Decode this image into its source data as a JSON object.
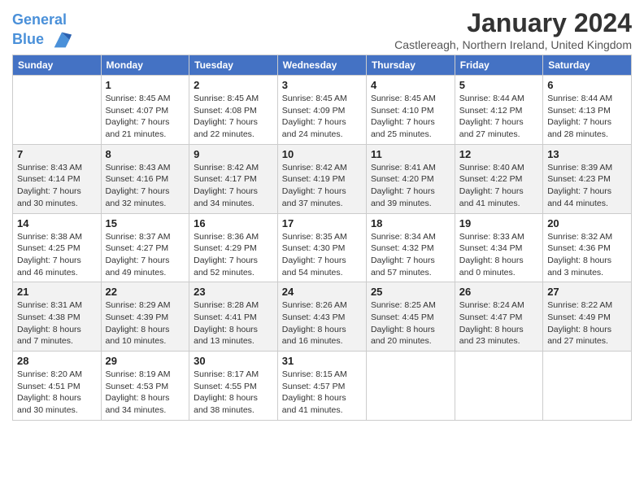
{
  "header": {
    "logo_line1": "General",
    "logo_line2": "Blue",
    "month_title": "January 2024",
    "location": "Castlereagh, Northern Ireland, United Kingdom"
  },
  "weekdays": [
    "Sunday",
    "Monday",
    "Tuesday",
    "Wednesday",
    "Thursday",
    "Friday",
    "Saturday"
  ],
  "weeks": [
    [
      {
        "day": "",
        "sunrise": "",
        "sunset": "",
        "daylight": ""
      },
      {
        "day": "1",
        "sunrise": "Sunrise: 8:45 AM",
        "sunset": "Sunset: 4:07 PM",
        "daylight": "Daylight: 7 hours and 21 minutes."
      },
      {
        "day": "2",
        "sunrise": "Sunrise: 8:45 AM",
        "sunset": "Sunset: 4:08 PM",
        "daylight": "Daylight: 7 hours and 22 minutes."
      },
      {
        "day": "3",
        "sunrise": "Sunrise: 8:45 AM",
        "sunset": "Sunset: 4:09 PM",
        "daylight": "Daylight: 7 hours and 24 minutes."
      },
      {
        "day": "4",
        "sunrise": "Sunrise: 8:45 AM",
        "sunset": "Sunset: 4:10 PM",
        "daylight": "Daylight: 7 hours and 25 minutes."
      },
      {
        "day": "5",
        "sunrise": "Sunrise: 8:44 AM",
        "sunset": "Sunset: 4:12 PM",
        "daylight": "Daylight: 7 hours and 27 minutes."
      },
      {
        "day": "6",
        "sunrise": "Sunrise: 8:44 AM",
        "sunset": "Sunset: 4:13 PM",
        "daylight": "Daylight: 7 hours and 28 minutes."
      }
    ],
    [
      {
        "day": "7",
        "sunrise": "Sunrise: 8:43 AM",
        "sunset": "Sunset: 4:14 PM",
        "daylight": "Daylight: 7 hours and 30 minutes."
      },
      {
        "day": "8",
        "sunrise": "Sunrise: 8:43 AM",
        "sunset": "Sunset: 4:16 PM",
        "daylight": "Daylight: 7 hours and 32 minutes."
      },
      {
        "day": "9",
        "sunrise": "Sunrise: 8:42 AM",
        "sunset": "Sunset: 4:17 PM",
        "daylight": "Daylight: 7 hours and 34 minutes."
      },
      {
        "day": "10",
        "sunrise": "Sunrise: 8:42 AM",
        "sunset": "Sunset: 4:19 PM",
        "daylight": "Daylight: 7 hours and 37 minutes."
      },
      {
        "day": "11",
        "sunrise": "Sunrise: 8:41 AM",
        "sunset": "Sunset: 4:20 PM",
        "daylight": "Daylight: 7 hours and 39 minutes."
      },
      {
        "day": "12",
        "sunrise": "Sunrise: 8:40 AM",
        "sunset": "Sunset: 4:22 PM",
        "daylight": "Daylight: 7 hours and 41 minutes."
      },
      {
        "day": "13",
        "sunrise": "Sunrise: 8:39 AM",
        "sunset": "Sunset: 4:23 PM",
        "daylight": "Daylight: 7 hours and 44 minutes."
      }
    ],
    [
      {
        "day": "14",
        "sunrise": "Sunrise: 8:38 AM",
        "sunset": "Sunset: 4:25 PM",
        "daylight": "Daylight: 7 hours and 46 minutes."
      },
      {
        "day": "15",
        "sunrise": "Sunrise: 8:37 AM",
        "sunset": "Sunset: 4:27 PM",
        "daylight": "Daylight: 7 hours and 49 minutes."
      },
      {
        "day": "16",
        "sunrise": "Sunrise: 8:36 AM",
        "sunset": "Sunset: 4:29 PM",
        "daylight": "Daylight: 7 hours and 52 minutes."
      },
      {
        "day": "17",
        "sunrise": "Sunrise: 8:35 AM",
        "sunset": "Sunset: 4:30 PM",
        "daylight": "Daylight: 7 hours and 54 minutes."
      },
      {
        "day": "18",
        "sunrise": "Sunrise: 8:34 AM",
        "sunset": "Sunset: 4:32 PM",
        "daylight": "Daylight: 7 hours and 57 minutes."
      },
      {
        "day": "19",
        "sunrise": "Sunrise: 8:33 AM",
        "sunset": "Sunset: 4:34 PM",
        "daylight": "Daylight: 8 hours and 0 minutes."
      },
      {
        "day": "20",
        "sunrise": "Sunrise: 8:32 AM",
        "sunset": "Sunset: 4:36 PM",
        "daylight": "Daylight: 8 hours and 3 minutes."
      }
    ],
    [
      {
        "day": "21",
        "sunrise": "Sunrise: 8:31 AM",
        "sunset": "Sunset: 4:38 PM",
        "daylight": "Daylight: 8 hours and 7 minutes."
      },
      {
        "day": "22",
        "sunrise": "Sunrise: 8:29 AM",
        "sunset": "Sunset: 4:39 PM",
        "daylight": "Daylight: 8 hours and 10 minutes."
      },
      {
        "day": "23",
        "sunrise": "Sunrise: 8:28 AM",
        "sunset": "Sunset: 4:41 PM",
        "daylight": "Daylight: 8 hours and 13 minutes."
      },
      {
        "day": "24",
        "sunrise": "Sunrise: 8:26 AM",
        "sunset": "Sunset: 4:43 PM",
        "daylight": "Daylight: 8 hours and 16 minutes."
      },
      {
        "day": "25",
        "sunrise": "Sunrise: 8:25 AM",
        "sunset": "Sunset: 4:45 PM",
        "daylight": "Daylight: 8 hours and 20 minutes."
      },
      {
        "day": "26",
        "sunrise": "Sunrise: 8:24 AM",
        "sunset": "Sunset: 4:47 PM",
        "daylight": "Daylight: 8 hours and 23 minutes."
      },
      {
        "day": "27",
        "sunrise": "Sunrise: 8:22 AM",
        "sunset": "Sunset: 4:49 PM",
        "daylight": "Daylight: 8 hours and 27 minutes."
      }
    ],
    [
      {
        "day": "28",
        "sunrise": "Sunrise: 8:20 AM",
        "sunset": "Sunset: 4:51 PM",
        "daylight": "Daylight: 8 hours and 30 minutes."
      },
      {
        "day": "29",
        "sunrise": "Sunrise: 8:19 AM",
        "sunset": "Sunset: 4:53 PM",
        "daylight": "Daylight: 8 hours and 34 minutes."
      },
      {
        "day": "30",
        "sunrise": "Sunrise: 8:17 AM",
        "sunset": "Sunset: 4:55 PM",
        "daylight": "Daylight: 8 hours and 38 minutes."
      },
      {
        "day": "31",
        "sunrise": "Sunrise: 8:15 AM",
        "sunset": "Sunset: 4:57 PM",
        "daylight": "Daylight: 8 hours and 41 minutes."
      },
      {
        "day": "",
        "sunrise": "",
        "sunset": "",
        "daylight": ""
      },
      {
        "day": "",
        "sunrise": "",
        "sunset": "",
        "daylight": ""
      },
      {
        "day": "",
        "sunrise": "",
        "sunset": "",
        "daylight": ""
      }
    ]
  ]
}
